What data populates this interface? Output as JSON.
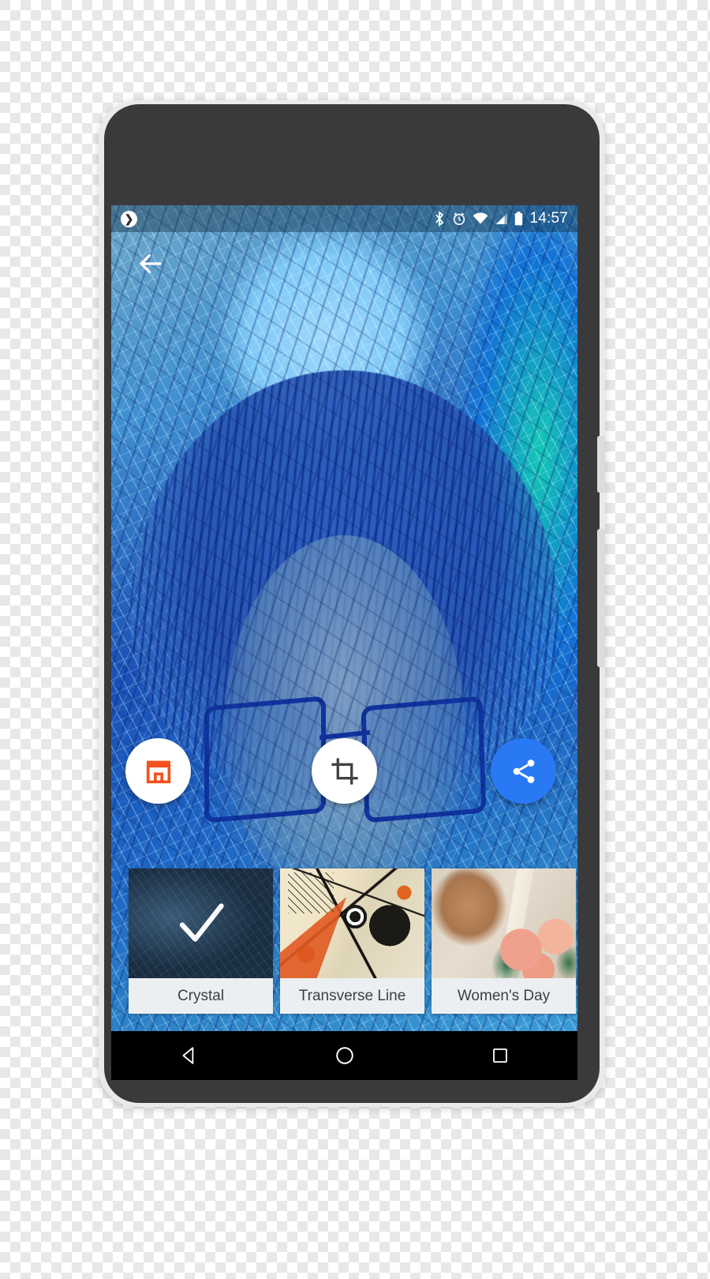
{
  "device": {
    "name": "android-phone-mockup",
    "frame_color": "#3a3a3c",
    "bezel_color": "#e9eaec"
  },
  "statusbar": {
    "notification_badge": "❯",
    "icons": [
      "bluetooth-icon",
      "alarm-icon",
      "wifi-icon",
      "cellular-signal-icon",
      "battery-icon"
    ],
    "time": "14:57",
    "background": "rgba(15,45,70,0.42)"
  },
  "appbar": {
    "back_icon": "back-arrow-icon"
  },
  "photo": {
    "description": "stylized blue crystal portrait of a person wearing glasses",
    "applied_style": "Crystal"
  },
  "actions": [
    {
      "id": "store",
      "icon": "store-icon",
      "color": "#f4511e",
      "background": "#ffffff"
    },
    {
      "id": "crop",
      "icon": "crop-icon",
      "color": "#424242",
      "background": "#ffffff"
    },
    {
      "id": "share",
      "icon": "share-icon",
      "color": "#ffffff",
      "background": "#2979f4"
    }
  ],
  "styles": [
    {
      "label": "Crystal",
      "selected": true,
      "check_icon": "check-icon"
    },
    {
      "label": "Transverse Line",
      "selected": false
    },
    {
      "label": "Women's Day",
      "selected": false
    }
  ],
  "navbar": {
    "buttons": [
      {
        "id": "back",
        "icon": "nav-back-triangle-icon"
      },
      {
        "id": "home",
        "icon": "nav-home-circle-icon"
      },
      {
        "id": "recents",
        "icon": "nav-recents-square-icon"
      }
    ],
    "background": "#000000"
  }
}
